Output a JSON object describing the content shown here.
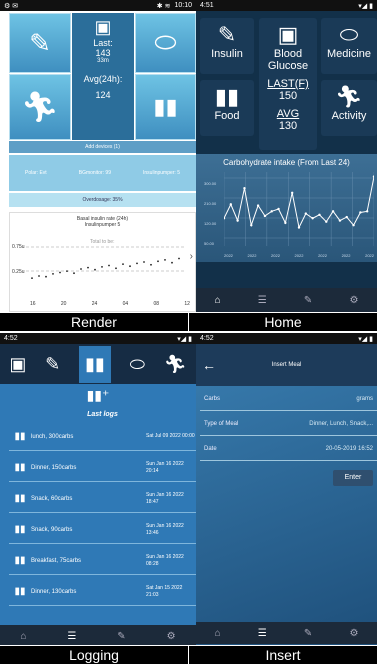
{
  "captions": {
    "render": "Render",
    "home": "Home",
    "logging": "Logging",
    "insert": "Insert"
  },
  "status": {
    "render": {
      "time": "10:10"
    },
    "home": {
      "time": "4:51"
    },
    "logging": {
      "time": "4:52"
    },
    "insert": {
      "time": "4:52"
    }
  },
  "render": {
    "last_label": "Last:",
    "last_value": "143",
    "last_time": "33m",
    "avg_label": "Avg(24h):",
    "avg_value": "124",
    "add_devices": "Add devices (1)",
    "info": [
      "Polar: Evt",
      "BGmonitor: 99",
      "Insulinpumper: 5"
    ],
    "overdosage": "Overdosage: 35%",
    "chart_title": "Basal insulin rate (24h)",
    "chart_sub": "Insulinpumper 5",
    "chart_note": "Total to be:",
    "yticks": [
      "0.75u",
      "0.25u"
    ],
    "xticks": [
      "16",
      "20",
      "24",
      "04",
      "08",
      "12"
    ]
  },
  "home": {
    "tiles": {
      "insulin": "Insulin",
      "blood_glucose": "Blood Glucose",
      "medicine": "Medicine",
      "food": "Food",
      "activity": "Activity"
    },
    "last_label": "LAST(F)",
    "last_value": "150",
    "avg_label": "AVG",
    "avg_value": "130",
    "chart_title": "Carbohydrate intake (From Last 24)",
    "yticks": [
      "300.00",
      "210.00",
      "120.00",
      "50.00"
    ],
    "xticks": [
      "2022",
      "2022",
      "2022",
      "2022",
      "2022",
      "2022",
      "2022"
    ],
    "chart_data": {
      "type": "line",
      "title": "Carbohydrate intake (From Last 24)",
      "values": [
        120,
        180,
        110,
        250,
        90,
        175,
        130,
        150,
        160,
        100,
        230,
        80,
        140,
        120,
        135,
        105,
        150,
        110,
        125,
        90,
        145,
        150,
        300
      ]
    }
  },
  "logging": {
    "header": "Last logs",
    "rows": [
      {
        "label": "lunch, 300carbs",
        "date": "Sat Jul 09 2022 00:00"
      },
      {
        "label": "Dinner, 150carbs",
        "date": "Sun Jan 16 2022 20:14"
      },
      {
        "label": "Snack, 60carbs",
        "date": "Sun Jan 16 2022 18:47"
      },
      {
        "label": "Snack, 90carbs",
        "date": "Sun Jan 16 2022 13:46"
      },
      {
        "label": "Breakfast, 75carbs",
        "date": "Sun Jan 16 2022 08:28"
      },
      {
        "label": "Dinner, 130carbs",
        "date": "Sat Jan 15 2022 21:03"
      }
    ]
  },
  "insert": {
    "title": "Insert Meal",
    "carbs_label": "Carbs",
    "carbs_placeholder": "grams",
    "type_label": "Type of Meal",
    "type_placeholder": "Dinner, Lunch, Snack,...",
    "date_label": "Date",
    "date_value": "20-05-2019 16:52",
    "enter": "Enter"
  }
}
